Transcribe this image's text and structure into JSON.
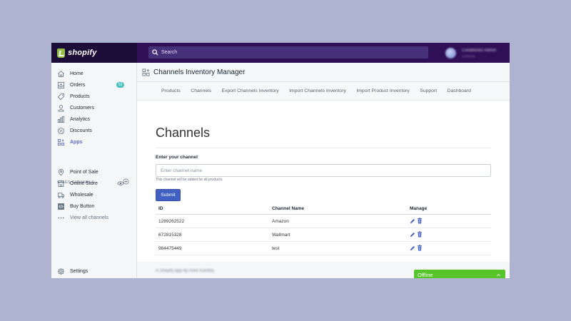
{
  "brand": {
    "name": "shopify"
  },
  "search": {
    "label": "Search"
  },
  "user": {
    "name": "CoolBlocks Admin",
    "store": "coolblocks"
  },
  "sidebar": {
    "items": [
      {
        "label": "Home",
        "icon": "home-icon"
      },
      {
        "label": "Orders",
        "icon": "orders-icon",
        "badge": "53"
      },
      {
        "label": "Products",
        "icon": "tag-icon"
      },
      {
        "label": "Customers",
        "icon": "person-icon"
      },
      {
        "label": "Analytics",
        "icon": "bar-chart-icon"
      },
      {
        "label": "Discounts",
        "icon": "discount-icon"
      },
      {
        "label": "Apps",
        "icon": "apps-icon",
        "active": true
      }
    ],
    "sales_channels_title": "SALES CHANNELS",
    "channels": [
      {
        "label": "Point of Sale",
        "icon": "location-icon"
      },
      {
        "label": "Online Store",
        "icon": "store-icon"
      },
      {
        "label": "Wholesale",
        "icon": "wholesale-icon"
      },
      {
        "label": "Buy Button",
        "icon": "code-icon"
      }
    ],
    "view_all": "View all channels",
    "settings": "Settings"
  },
  "header": {
    "title": "Channels Inventory Manager"
  },
  "tabs": [
    "Products",
    "Channels",
    "Export Channels Inventory",
    "Import Channels Inventory",
    "Import Product Inventory",
    "Support",
    "Dashboard"
  ],
  "form": {
    "heading": "Channels",
    "label": "Enter your channel",
    "placeholder": "Enter channel name",
    "help": "This channel will be added for all products.",
    "submit": "Submit"
  },
  "table": {
    "columns": [
      "ID",
      "Channel Name",
      "Manage"
    ],
    "rows": [
      {
        "id": "1289262522",
        "name": "Amazon"
      },
      {
        "id": "672815328",
        "name": "Wallmart"
      },
      {
        "id": "984475449",
        "name": "test"
      }
    ]
  },
  "footer": {
    "text": "A Shopify app by Ankit Kamboj"
  },
  "chat": {
    "label": "Offline"
  },
  "colors": {
    "topbar": "#2f0f55",
    "accent": "#5c6ac4",
    "submit": "#4161c2",
    "chat": "#57c42a",
    "badge": "#47c1bf"
  }
}
